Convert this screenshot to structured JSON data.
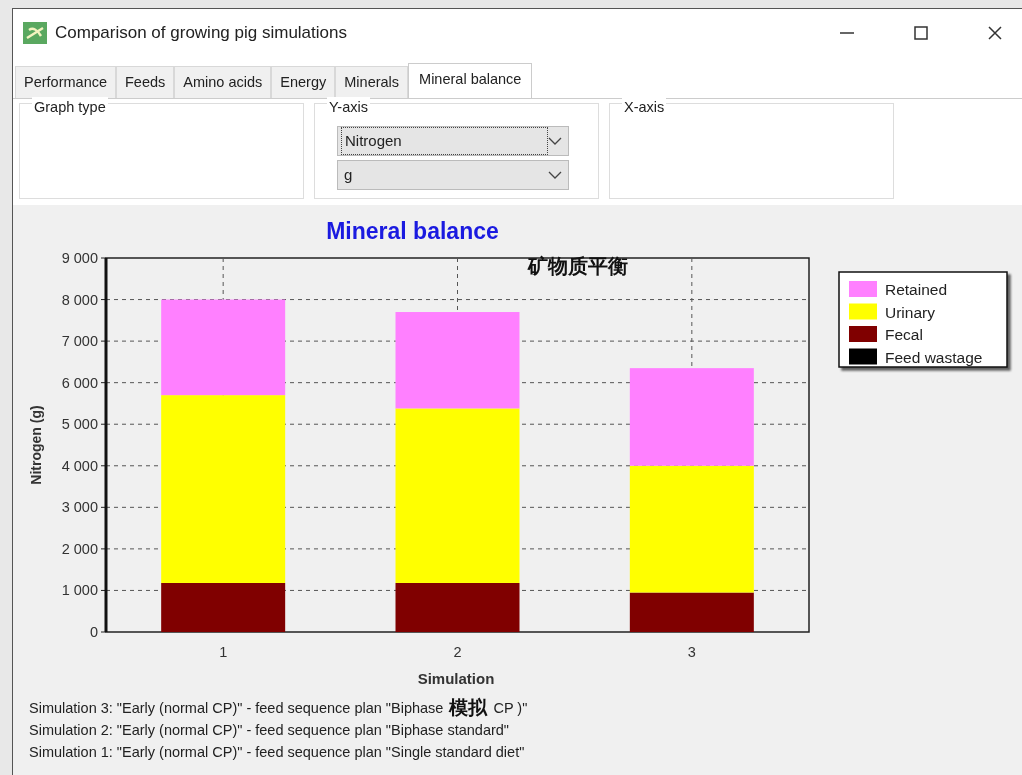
{
  "window": {
    "title": "Comparison of growing pig simulations"
  },
  "tabs": [
    {
      "label": "Performance",
      "selected": false
    },
    {
      "label": "Feeds",
      "selected": false
    },
    {
      "label": "Amino acids",
      "selected": false
    },
    {
      "label": "Energy",
      "selected": false
    },
    {
      "label": "Minerals",
      "selected": false
    },
    {
      "label": "Mineral balance",
      "selected": true
    }
  ],
  "groups": [
    {
      "label": "Graph type"
    },
    {
      "label": "Y-axis",
      "selects": [
        {
          "value": "Nitrogen",
          "focused": true
        },
        {
          "value": "g",
          "focused": false
        }
      ]
    },
    {
      "label": "X-axis"
    }
  ],
  "chart": {
    "annotation": "矿物质平衡",
    "xlabel_annotation": "模拟",
    "chart_data": {
      "type": "bar",
      "stacked": true,
      "grid": true,
      "legend": true,
      "title": "Mineral balance",
      "xlabel": "Simulation",
      "ylabel": "Nitrogen (g)",
      "categories": [
        "1",
        "2",
        "3"
      ],
      "ylim": [
        0,
        9000
      ],
      "yticks": [
        {
          "value": 0,
          "label": "0"
        },
        {
          "value": 1000,
          "label": "1 000"
        },
        {
          "value": 2000,
          "label": "2 000"
        },
        {
          "value": 3000,
          "label": "3 000"
        },
        {
          "value": 4000,
          "label": "4 000"
        },
        {
          "value": 5000,
          "label": "5 000"
        },
        {
          "value": 6000,
          "label": "6 000"
        },
        {
          "value": 7000,
          "label": "7 000"
        },
        {
          "value": 8000,
          "label": "8 000"
        },
        {
          "value": 9000,
          "label": "9 000"
        }
      ],
      "series": [
        {
          "name": "Feed wastage",
          "color": "#000000",
          "values": [
            0,
            0,
            0
          ]
        },
        {
          "name": "Fecal",
          "color": "#800000",
          "values": [
            1180,
            1180,
            950
          ]
        },
        {
          "name": "Urinary",
          "color": "#ffff00",
          "values": [
            4520,
            4200,
            3050
          ]
        },
        {
          "name": "Retained",
          "color": "#ff80ff",
          "values": [
            2300,
            2320,
            2350
          ]
        }
      ]
    }
  },
  "footnotes": [
    {
      "text": "Simulation 3: \"Early (normal CP)\" - feed sequence plan \"Biphase",
      "tail": "CP )\""
    },
    {
      "text": "Simulation 2: \"Early (normal CP)\" - feed sequence plan \"Biphase standard\""
    },
    {
      "text": "Simulation 1: \"Early (normal CP)\" - feed sequence plan \"Single standard diet\""
    }
  ]
}
